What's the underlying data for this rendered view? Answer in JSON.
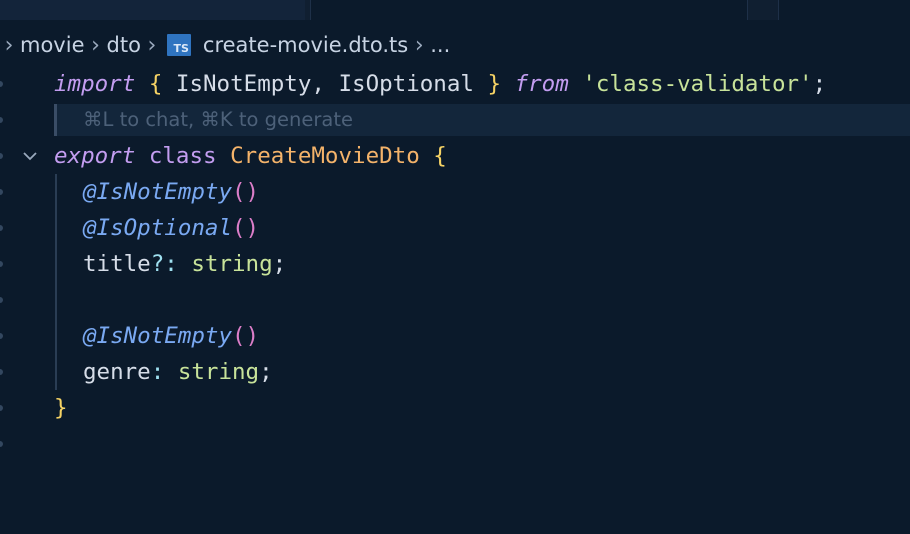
{
  "breadcrumb": {
    "items": [
      "movie",
      "dto",
      "create-movie.dto.ts",
      "..."
    ],
    "file_badge": "TS"
  },
  "hint": {
    "text": "⌘L to chat, ⌘K to generate"
  },
  "code": {
    "line1": {
      "kw_import": "import",
      "brace_open": " { ",
      "names": "IsNotEmpty, IsOptional",
      "brace_close": " } ",
      "kw_from": "from",
      "space": " ",
      "module": "'class-validator'",
      "semi": ";"
    },
    "line3": {
      "kw_export": "export",
      "kw_class": " class ",
      "class_name": "CreateMovieDto",
      "brace": " {"
    },
    "line4": {
      "decorator": "@IsNotEmpty",
      "parens": "()"
    },
    "line5": {
      "decorator": "@IsOptional",
      "parens": "()"
    },
    "line6": {
      "prop": "title",
      "opt": "?",
      "colon": ": ",
      "type": "string",
      "semi": ";"
    },
    "line8": {
      "decorator": "@IsNotEmpty",
      "parens": "()"
    },
    "line9": {
      "prop": "genre",
      "colon": ": ",
      "type": "string",
      "semi": ";"
    },
    "line10": {
      "brace": "}"
    }
  },
  "colors": {
    "background": "#0b1a2b",
    "keyword": "#c39df0",
    "class_name": "#f4b36a",
    "string": "#c8e39a",
    "decorator": "#7aa9f2",
    "brace": "#f6d365"
  }
}
